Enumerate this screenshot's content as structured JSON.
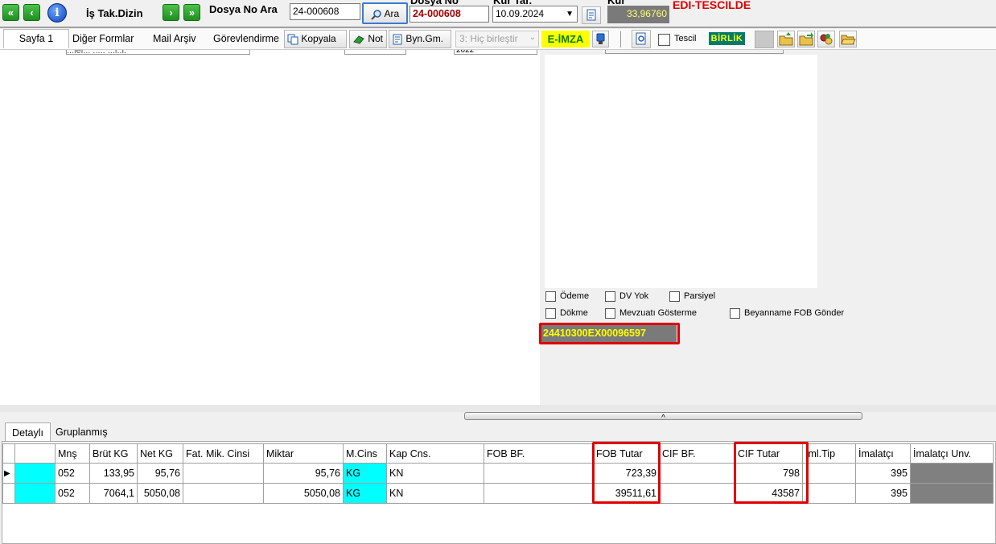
{
  "toolbar": {
    "first_icon": "«",
    "prev_icon": "‹",
    "info_icon": "i",
    "title": "İş Tak.Dizin",
    "next_icon": "›",
    "last_icon": "»",
    "search_label": "Dosya No Ara",
    "search_value": "24-000608",
    "search_button": "Ara",
    "file_no_label": "Dosya No",
    "file_no_value": "24-000608",
    "rate_date_label": "Kur Tar.",
    "rate_date_value": "10.09.2024",
    "rate_label": "Kur",
    "rate_value": "33,96760",
    "status": "EDI-TESCILDE"
  },
  "tabs": [
    "Sayfa 1",
    "Diğer Formlar",
    "Mail Arşiv",
    "Görevlendirme"
  ],
  "actions": {
    "copy": "Kopyala",
    "note": "Not",
    "byn": "Byn.Gm.",
    "merge_select": "3: Hiç birleştir",
    "eimza": "E-İMZA",
    "tescil": "Tescil",
    "birlik": "BİRLİK"
  },
  "partial": {
    "field1": "2022",
    "field2": "...lel... ..... ...l..l."
  },
  "checkboxes": {
    "odeme": "Ödeme",
    "dv_yok": "DV Yok",
    "parsiyel": "Parsiyel",
    "dokme": "Dökme",
    "mevzuati": "Mevzuatı Gösterme",
    "fob_gonder": "Beyanname FOB Gönder"
  },
  "declaration_no": "24410300EX00096597",
  "bottom_tabs": [
    "Detaylı",
    "Gruplanmış"
  ],
  "grid": {
    "columns": [
      "",
      "Mnş",
      "Brüt KG",
      "Net KG",
      "Fat. Mik. Cinsi",
      "Miktar",
      "M.Cins",
      "Kap Cns.",
      "FOB BF.",
      "FOB Tutar",
      "CIF BF.",
      "CIF Tutar",
      "İml.Tip",
      "İmalatçı",
      "İmalatçı Unv."
    ],
    "rows": [
      {
        "indicator": "▶",
        "mns": "052",
        "brut": "133,95",
        "net": "95,76",
        "fat": "",
        "miktar": "95,76",
        "mcins": "KG",
        "kap": "KN",
        "fobbf": "",
        "fob": "723,39",
        "cifbf": "",
        "cif": "798",
        "iml": "",
        "imalatci": "395",
        "unv": ""
      },
      {
        "indicator": "",
        "mns": "052",
        "brut": "7064,1",
        "net": "5050,08",
        "fat": "",
        "miktar": "5050,08",
        "mcins": "KG",
        "kap": "KN",
        "fobbf": "",
        "fob": "39511,61",
        "cifbf": "",
        "cif": "43587",
        "iml": "",
        "imalatci": "395",
        "unv": ""
      }
    ]
  },
  "colors": {
    "accent_red": "#e00000",
    "cyan": "#00ffff",
    "eimza_bg": "#ffff00",
    "birlik_bg": "#007a6e"
  }
}
